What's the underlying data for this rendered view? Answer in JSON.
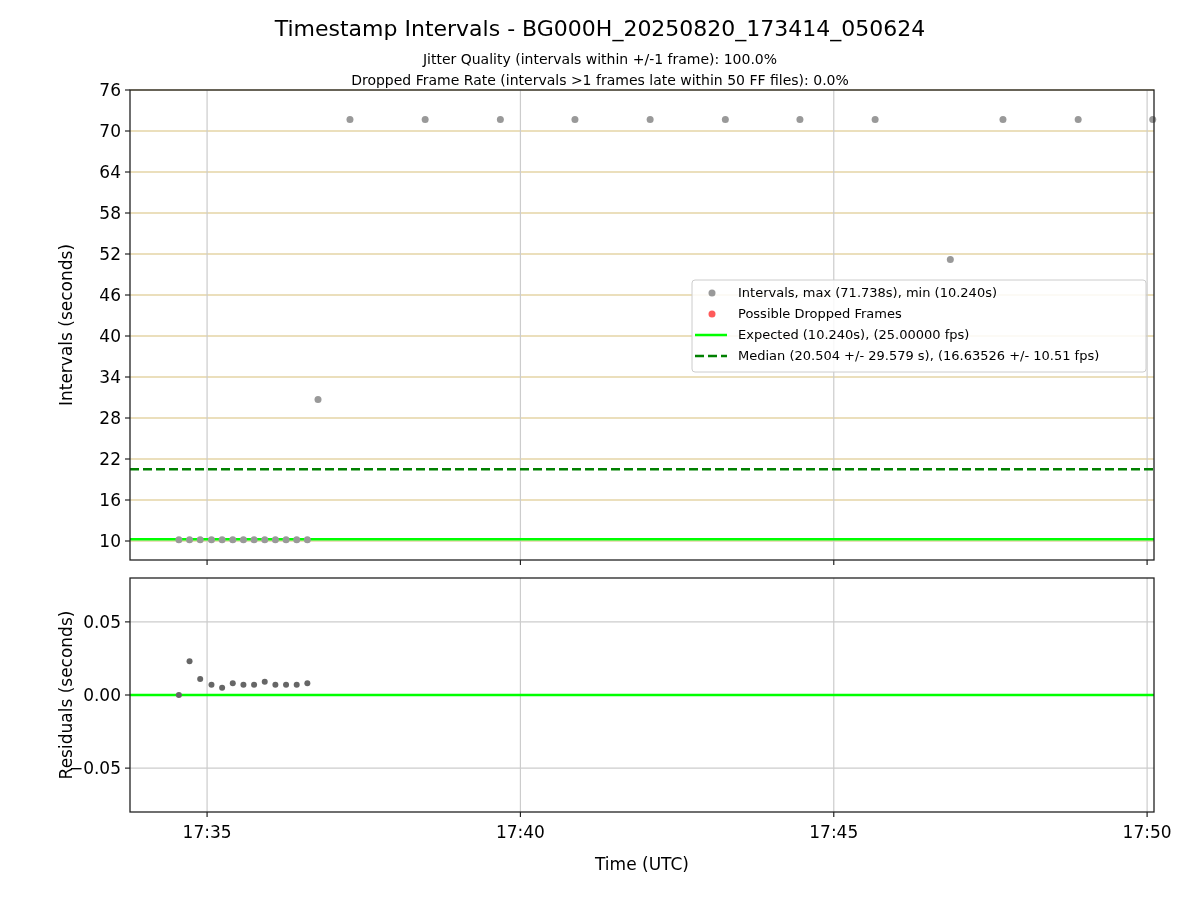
{
  "figure": {
    "title": "Timestamp Intervals - BG000H_20250820_173414_050624",
    "subtitles": [
      "Jitter Quality (intervals within +/-1 frame): 100.0%",
      "Dropped Frame Rate (intervals >1 frames late within 50 FF files): 0.0%"
    ]
  },
  "intervals_plot": {
    "chart_data": {
      "type": "scatter",
      "ylabel": "Intervals (seconds)",
      "grid": true,
      "legend": "center right",
      "xlim": [
        1053.77,
        1070.11
      ],
      "ylim": [
        7.22,
        76
      ],
      "yticks": [
        {
          "value": 10,
          "label": "10"
        },
        {
          "value": 16,
          "label": "16"
        },
        {
          "value": 22,
          "label": "22"
        },
        {
          "value": 28,
          "label": "28"
        },
        {
          "value": 34,
          "label": "34"
        },
        {
          "value": 40,
          "label": "40"
        },
        {
          "value": 46,
          "label": "46"
        },
        {
          "value": 52,
          "label": "52"
        },
        {
          "value": 58,
          "label": "58"
        },
        {
          "value": 64,
          "label": "64"
        },
        {
          "value": 70,
          "label": "70"
        },
        {
          "value": 76,
          "label": "76"
        }
      ],
      "series": [
        {
          "name": "Intervals, max (71.738s), min (10.240s)",
          "color": "#999999",
          "x": [
            1054.55,
            1054.72,
            1054.89,
            1055.07,
            1055.24,
            1055.41,
            1055.58,
            1055.75,
            1055.92,
            1056.09,
            1056.26,
            1056.43,
            1056.6,
            1056.77,
            1057.28,
            1058.48,
            1059.68,
            1060.87,
            1062.07,
            1063.27,
            1064.46,
            1065.66,
            1066.86,
            1067.7,
            1068.9,
            1070.09
          ],
          "values": [
            10.2,
            10.2,
            10.2,
            10.2,
            10.2,
            10.2,
            10.2,
            10.2,
            10.2,
            10.2,
            10.2,
            10.2,
            10.2,
            30.7,
            71.7,
            71.7,
            71.7,
            71.7,
            71.7,
            71.7,
            71.7,
            71.7,
            51.2,
            71.7,
            71.7,
            71.7
          ]
        },
        {
          "name": "Possible Dropped Frames",
          "color": "#ff5a5a"
        }
      ],
      "ref_lines": [
        {
          "axis": "y",
          "value": 10.24,
          "label": "Expected (10.240s), (25.00000 fps)",
          "color": "#00ff00"
        },
        {
          "axis": "y",
          "value": 20.5,
          "label": "Median (20.504 +/- 29.579 s), (16.63526 +/- 10.51 fps)",
          "color": "#008000"
        }
      ]
    }
  },
  "residuals_plot": {
    "chart_data": {
      "type": "scatter",
      "xlabel": "Time (UTC)",
      "ylabel": "Residuals (seconds)",
      "grid": true,
      "xlim": [
        1053.77,
        1070.11
      ],
      "ylim": [
        -0.08,
        0.08
      ],
      "xticks": [
        {
          "value": 1055,
          "label": "17:35"
        },
        {
          "value": 1060,
          "label": "17:40"
        },
        {
          "value": 1065,
          "label": "17:45"
        },
        {
          "value": 1070,
          "label": "17:50"
        }
      ],
      "yticks": [
        {
          "value": 0.05,
          "label": "0.05"
        },
        {
          "value": 0,
          "label": "0.00"
        },
        {
          "value": -0.05,
          "label": "−0.05"
        }
      ],
      "series": [
        {
          "color": "#666666",
          "x": [
            1054.55,
            1054.72,
            1054.89,
            1055.07,
            1055.24,
            1055.41,
            1055.58,
            1055.75,
            1055.92,
            1056.09,
            1056.26,
            1056.43,
            1056.6
          ],
          "values": [
            0,
            0.023,
            0.011,
            0.007,
            0.005,
            0.008,
            0.007,
            0.007,
            0.009,
            0.007,
            0.007,
            0.007,
            0.008
          ]
        }
      ],
      "ref_lines": [
        {
          "axis": "y",
          "value": 0,
          "color": "#00ff00"
        }
      ]
    }
  }
}
